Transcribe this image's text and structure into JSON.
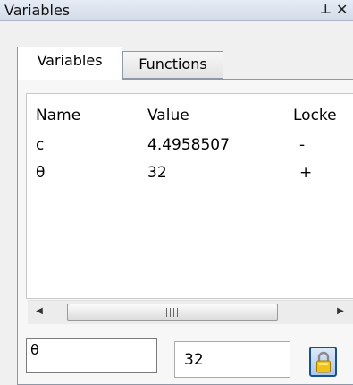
{
  "window": {
    "title": "Variables",
    "pin_icon": "pin-icon",
    "close_icon": "close-icon"
  },
  "tabs": [
    {
      "label": "Variables",
      "active": true
    },
    {
      "label": "Functions",
      "active": false
    }
  ],
  "table": {
    "columns": [
      "Name",
      "Value",
      "Locke"
    ],
    "rows": [
      {
        "name": "c",
        "value": "4.4958507",
        "locked": "-"
      },
      {
        "name": "θ",
        "value": "32",
        "locked": "+"
      }
    ]
  },
  "scrollbar": {
    "left_icon": "chevron-left-icon",
    "right_icon": "chevron-right-icon"
  },
  "editor": {
    "name_value": "θ",
    "value_value": "32",
    "lock_icon": "lock-icon"
  },
  "colors": {
    "accent": "#1d4f8f",
    "lock_body": "#f2c21a"
  }
}
